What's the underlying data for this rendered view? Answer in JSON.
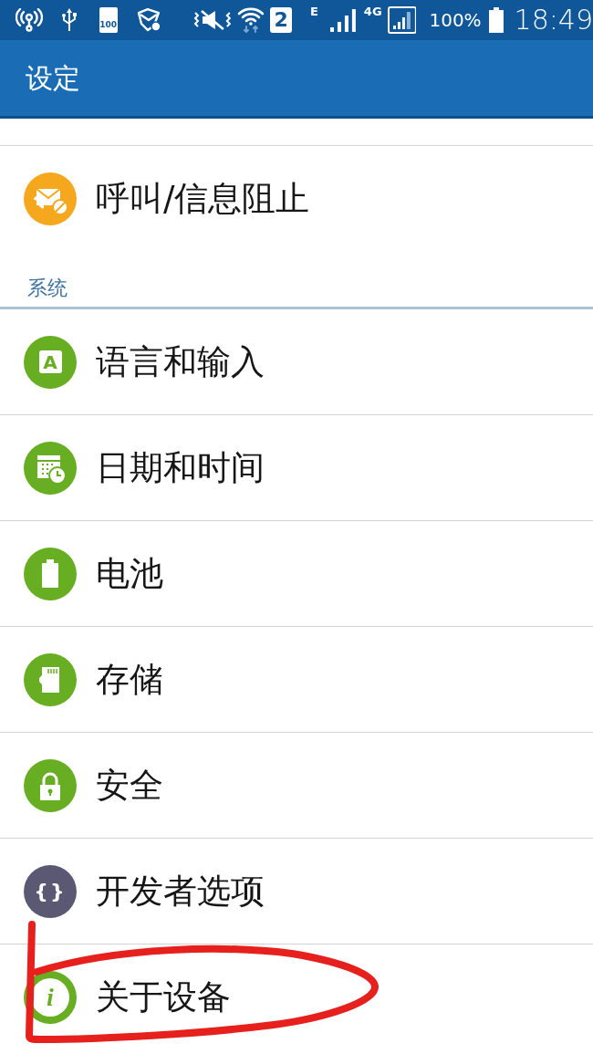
{
  "status_bar": {
    "battery_saver": "100",
    "sim_slot": "2",
    "network_1": "E",
    "network_2": "4G",
    "battery_percent": "100%",
    "time": "18:49"
  },
  "app_bar": {
    "title": "设定"
  },
  "sections": [
    {
      "items": [
        {
          "label": "呼叫/信息阻止",
          "color": "#f5a81e",
          "circled": false
        }
      ]
    },
    {
      "header": "系统",
      "items": [
        {
          "label": "语言和输入",
          "color": "#68ae22",
          "glyph": "A",
          "circled": false
        },
        {
          "label": "日期和时间",
          "color": "#68ae22",
          "circled": false
        },
        {
          "label": "电池",
          "color": "#68ae22",
          "circled": false
        },
        {
          "label": "存储",
          "color": "#68ae22",
          "circled": false
        },
        {
          "label": "安全",
          "color": "#68ae22",
          "circled": false
        },
        {
          "label": "开发者选项",
          "color": "#5b5874",
          "glyph": "{}",
          "circled": false
        },
        {
          "label": "关于设备",
          "color": "#68ae22",
          "glyph": "i",
          "circled": true
        }
      ]
    }
  ]
}
